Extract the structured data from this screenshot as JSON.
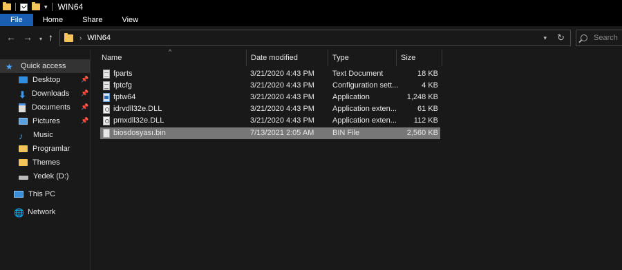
{
  "window": {
    "title": "WIN64"
  },
  "ribbon": {
    "tabs": [
      {
        "label": "File"
      },
      {
        "label": "Home"
      },
      {
        "label": "Share"
      },
      {
        "label": "View"
      }
    ]
  },
  "address": {
    "path_item": "WIN64",
    "chevron": "›"
  },
  "search": {
    "placeholder": "Search"
  },
  "sidebar": {
    "quick_access": "Quick access",
    "items": [
      {
        "label": "Desktop",
        "icon": "desktop-icon",
        "pinned": true
      },
      {
        "label": "Downloads",
        "icon": "downloads-icon",
        "pinned": true
      },
      {
        "label": "Documents",
        "icon": "documents-icon",
        "pinned": true
      },
      {
        "label": "Pictures",
        "icon": "pictures-icon",
        "pinned": true
      },
      {
        "label": "Music",
        "icon": "music-icon",
        "pinned": false
      },
      {
        "label": "Programlar",
        "icon": "folder-icon",
        "pinned": false
      },
      {
        "label": "Themes",
        "icon": "folder-icon",
        "pinned": false
      },
      {
        "label": "Yedek (D:)",
        "icon": "drive-icon",
        "pinned": false
      }
    ],
    "this_pc": "This PC",
    "network": "Network"
  },
  "columns": {
    "name": "Name",
    "date": "Date modified",
    "type": "Type",
    "size": "Size"
  },
  "files": [
    {
      "name": "fparts",
      "date": "3/21/2020 4:43 PM",
      "type": "Text Document",
      "size": "18 KB",
      "icon": "text-file-icon"
    },
    {
      "name": "fptcfg",
      "date": "3/21/2020 4:43 PM",
      "type": "Configuration sett...",
      "size": "4 KB",
      "icon": "config-file-icon"
    },
    {
      "name": "fptw64",
      "date": "3/21/2020 4:43 PM",
      "type": "Application",
      "size": "1,248 KB",
      "icon": "application-icon"
    },
    {
      "name": "idrvdll32e.DLL",
      "date": "3/21/2020 4:43 PM",
      "type": "Application exten...",
      "size": "61 KB",
      "icon": "dll-file-icon"
    },
    {
      "name": "pmxdll32e.DLL",
      "date": "3/21/2020 4:43 PM",
      "type": "Application exten...",
      "size": "112 KB",
      "icon": "dll-file-icon"
    },
    {
      "name": "biosdosyası.bin",
      "date": "7/13/2021 2:05 AM",
      "type": "BIN File",
      "size": "2,560 KB",
      "icon": "bin-file-icon",
      "selected": true
    }
  ]
}
